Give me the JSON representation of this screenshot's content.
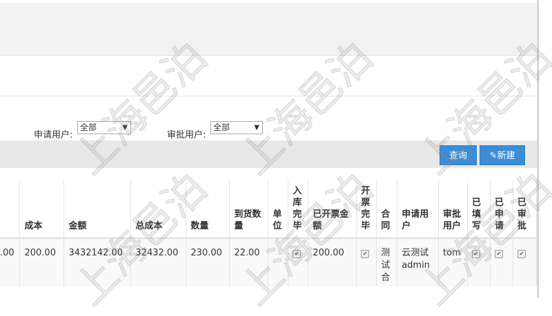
{
  "filters": {
    "applicant_label": "申请用户:",
    "applicant_value": "全部",
    "approver_label": "审批用户:",
    "approver_value": "全部"
  },
  "toolbar": {
    "query_label": "查询",
    "new_label": "新建"
  },
  "table": {
    "headers": {
      "partial": "",
      "cost": "成本",
      "amount": "金额",
      "total_cost": "总成本",
      "quantity": "数量",
      "arrived_qty": "到货数量",
      "unit": "单位",
      "stock_in_done": "入库完毕",
      "invoiced_amount": "已开票金额",
      "invoice_done": "开票完毕",
      "contract": "合同",
      "applicant": "申请用户",
      "approver": "审批用户",
      "filled": "已填写",
      "applied": "已申请",
      "approved": "已审批"
    },
    "row": {
      "partial": ".00",
      "cost": "200.00",
      "amount": "3432142.00",
      "total_cost": "32432.00",
      "quantity": "230.00",
      "arrived_qty": "22.00",
      "unit": "",
      "invoiced_amount": "200.00",
      "contract": "测试合",
      "applicant": "云测试admin",
      "approver": "tom",
      "check_mark": "✔"
    }
  },
  "watermark": {
    "text": "上海邑泊"
  },
  "colors": {
    "primary_button": "#3c8dd6",
    "toolbar_bg": "#e8e8e8"
  }
}
